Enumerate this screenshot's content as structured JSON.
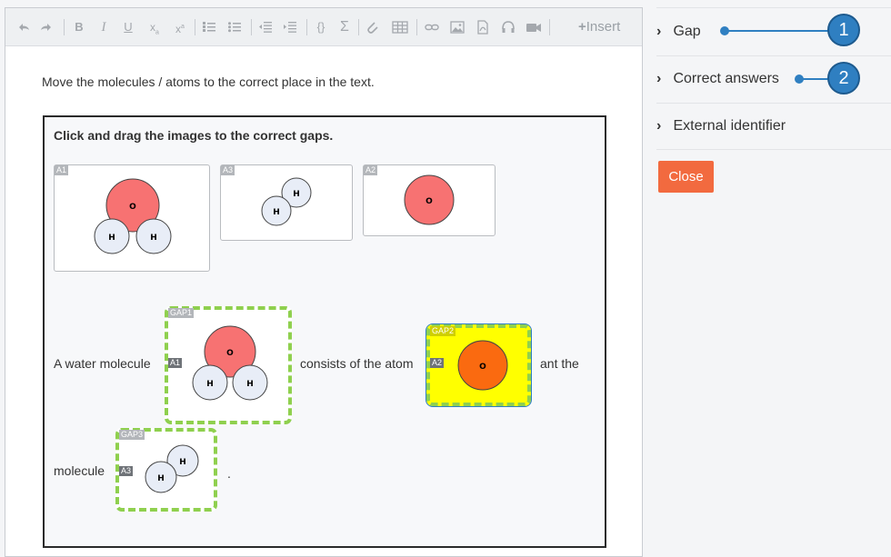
{
  "toolbar": {
    "insert_label": "Insert",
    "items": [
      "undo-icon",
      "redo-icon",
      "bold-icon",
      "italic-icon",
      "underline-icon",
      "subscript-icon",
      "superscript-icon",
      "ordered-list-icon",
      "bullet-list-icon",
      "outdent-icon",
      "indent-icon",
      "code-icon",
      "sigma-icon",
      "attachment-icon",
      "table-icon",
      "link-icon",
      "image-icon",
      "pdf-icon",
      "audio-icon",
      "video-icon"
    ]
  },
  "content": {
    "intro": "Move the molecules / atoms to the correct place in the text.",
    "question_title": "Click and drag the images to the correct gaps.",
    "sources": [
      {
        "tag": "A1",
        "atoms": [
          "O",
          "H",
          "H"
        ]
      },
      {
        "tag": "A3",
        "atoms": [
          "H",
          "H"
        ]
      },
      {
        "tag": "A2",
        "atoms": [
          "O"
        ]
      }
    ],
    "sentence1_a": "A water molecule",
    "sentence1_b": "consists of the atom",
    "sentence1_c": "ant the",
    "sentence2_a": "molecule",
    "sentence2_b": ".",
    "gaps": [
      {
        "tag": "GAP1",
        "answer": "A1"
      },
      {
        "tag": "GAP2",
        "answer": "A2"
      },
      {
        "tag": "GAP3",
        "answer": "A3"
      }
    ]
  },
  "sidebar": {
    "items": [
      {
        "label": "Gap"
      },
      {
        "label": "Correct answers"
      },
      {
        "label": "External identifier"
      }
    ],
    "close_label": "Close",
    "callouts": [
      "1",
      "2"
    ]
  },
  "colors": {
    "accent": "#f26a3f",
    "callout": "#2f7fc1",
    "gap_border": "#8fd04e",
    "gap_highlight": "#ffff00",
    "oxygen": "#f77272",
    "hydrogen": "#e8edf7"
  }
}
